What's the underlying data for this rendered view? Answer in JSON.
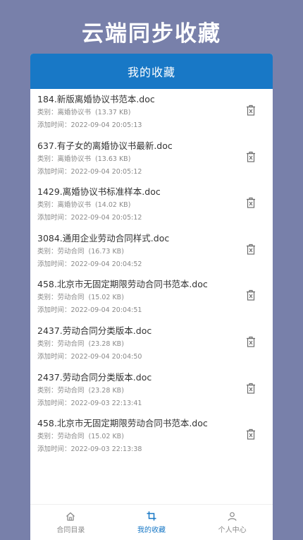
{
  "banner": {
    "title": "云端同步收藏"
  },
  "header": {
    "title": "我的收藏"
  },
  "colors": {
    "brand": "#1878c6",
    "background": "#7880aa"
  },
  "items": [
    {
      "title": "184.新版离婚协议书范本.doc",
      "category_label": "类别：",
      "category": "离婚协议书",
      "size": "(13.37 KB)",
      "time_label": "添加时间：",
      "time": "2022-09-04 20:05:13"
    },
    {
      "title": "637.有子女的离婚协议书最新.doc",
      "category_label": "类别：",
      "category": "离婚协议书",
      "size": "(13.63 KB)",
      "time_label": "添加时间：",
      "time": "2022-09-04 20:05:12"
    },
    {
      "title": "1429.离婚协议书标准样本.doc",
      "category_label": "类别：",
      "category": "离婚协议书",
      "size": "(14.02 KB)",
      "time_label": "添加时间：",
      "time": "2022-09-04 20:05:12"
    },
    {
      "title": "3084.通用企业劳动合同样式.doc",
      "category_label": "类别：",
      "category": "劳动合同",
      "size": "(16.73 KB)",
      "time_label": "添加时间：",
      "time": "2022-09-04 20:04:52"
    },
    {
      "title": "458.北京市无固定期限劳动合同书范本.doc",
      "category_label": "类别：",
      "category": "劳动合同",
      "size": "(15.02 KB)",
      "time_label": "添加时间：",
      "time": "2022-09-04 20:04:51"
    },
    {
      "title": "2437.劳动合同分类版本.doc",
      "category_label": "类别：",
      "category": "劳动合同",
      "size": "(23.28 KB)",
      "time_label": "添加时间：",
      "time": "2022-09-04 20:04:50"
    },
    {
      "title": "2437.劳动合同分类版本.doc",
      "category_label": "类别：",
      "category": "劳动合同",
      "size": "(23.28 KB)",
      "time_label": "添加时间：",
      "time": "2022-09-03 22:13:41"
    },
    {
      "title": "458.北京市无固定期限劳动合同书范本.doc",
      "category_label": "类别：",
      "category": "劳动合同",
      "size": "(15.02 KB)",
      "time_label": "添加时间：",
      "time": "2022-09-03 22:13:38"
    }
  ],
  "tabs": [
    {
      "label": "合同目录",
      "icon": "home-icon",
      "active": false
    },
    {
      "label": "我的收藏",
      "icon": "crop-icon",
      "active": true
    },
    {
      "label": "个人中心",
      "icon": "user-icon",
      "active": false
    }
  ]
}
